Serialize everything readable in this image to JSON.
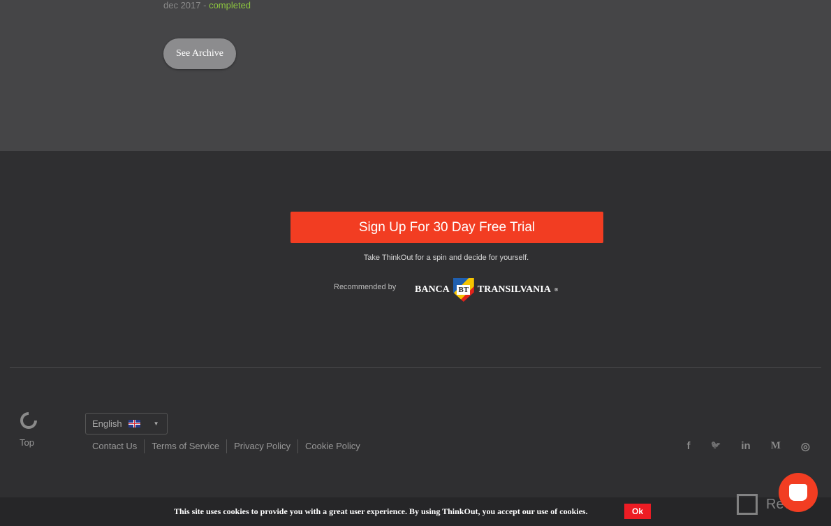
{
  "archive": {
    "date": "dec 2017",
    "separator": " - ",
    "status": "completed",
    "button": "See Archive"
  },
  "cta": {
    "button": "Sign Up For 30 Day Free Trial",
    "tagline": "Take ThinkOut for a spin and decide for yourself.",
    "recommended": "Recommended by",
    "partner_left": "BANCA",
    "partner_logo": "BT",
    "partner_right": "TRANSILVANIA",
    "partner_mark": "®"
  },
  "footer": {
    "top_label": "Top",
    "language": "English",
    "links": [
      "Contact Us",
      "Terms of Service",
      "Privacy Policy",
      "Cookie Policy"
    ],
    "social": [
      {
        "icon": "facebook-icon",
        "glyph": "f"
      },
      {
        "icon": "twitter-icon",
        "glyph": "🐦"
      },
      {
        "icon": "linkedin-icon",
        "glyph": "in"
      },
      {
        "icon": "medium-icon",
        "glyph": "M"
      },
      {
        "icon": "instagram-icon",
        "glyph": "◎"
      }
    ]
  },
  "cookie": {
    "text": "This site uses cookies to provide you with a great user experience. By using ThinkOut, you accept our use of cookies.",
    "ok": "Ok"
  },
  "watermark": "Revain",
  "colors": {
    "accent": "#f23d22",
    "completed": "#8dc63f",
    "ok": "#ed1c24"
  }
}
